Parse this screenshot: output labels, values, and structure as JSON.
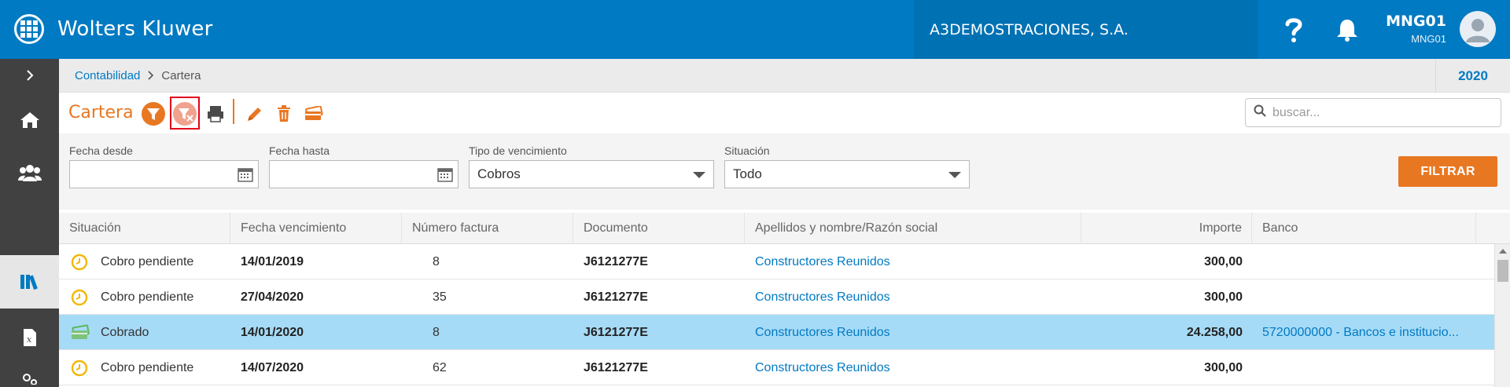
{
  "header": {
    "brand": "Wolters Kluwer",
    "company": "A3DEMOSTRACIONES, S.A.",
    "user_name": "MNG01",
    "user_sub": "MNG01",
    "icons": [
      "logo-icon",
      "help-icon",
      "bell-icon",
      "avatar-icon"
    ]
  },
  "sidebar": {
    "items": [
      {
        "name": "expand",
        "icon": "chevron-right-icon"
      },
      {
        "name": "home",
        "icon": "home-icon"
      },
      {
        "name": "contacts",
        "icon": "users-icon"
      },
      {
        "name": "library",
        "icon": "books-icon",
        "active": true
      },
      {
        "name": "excel",
        "icon": "spreadsheet-icon"
      },
      {
        "name": "settings",
        "icon": "gears-icon"
      }
    ]
  },
  "breadcrumb": {
    "parent": "Contabilidad",
    "separator": ">",
    "current": "Cartera",
    "year": "2020"
  },
  "toolbar": {
    "title": "Cartera",
    "buttons": [
      "filter-icon",
      "clear-filter-icon",
      "print-icon",
      "edit-icon",
      "delete-icon",
      "payment-card-icon"
    ],
    "search_placeholder": "buscar..."
  },
  "filters": {
    "fecha_desde": {
      "label": "Fecha desde",
      "value": ""
    },
    "fecha_hasta": {
      "label": "Fecha hasta",
      "value": ""
    },
    "tipo": {
      "label": "Tipo de vencimiento",
      "value": "Cobros"
    },
    "situacion": {
      "label": "Situación",
      "value": "Todo"
    },
    "button": "FILTRAR"
  },
  "table": {
    "columns": [
      "Situación",
      "Fecha vencimiento",
      "Número factura",
      "Documento",
      "Apellidos y nombre/Razón social",
      "Importe",
      "Banco"
    ],
    "rows": [
      {
        "situacion": "Cobro pendiente",
        "icon": "clock-icon",
        "fecha": "14/01/2019",
        "numero": "8",
        "documento": "J6121277E",
        "nombre": "Constructores Reunidos",
        "importe": "300,00",
        "banco": ""
      },
      {
        "situacion": "Cobro pendiente",
        "icon": "clock-icon",
        "fecha": "27/04/2020",
        "numero": "35",
        "documento": "J6121277E",
        "nombre": "Constructores Reunidos",
        "importe": "300,00",
        "banco": ""
      },
      {
        "situacion": "Cobrado",
        "icon": "money-icon",
        "fecha": "14/01/2020",
        "numero": "8",
        "documento": "J6121277E",
        "nombre": "Constructores Reunidos",
        "importe": "24.258,00",
        "banco": "5720000000 - Bancos e institucio...",
        "selected": true
      },
      {
        "situacion": "Cobro pendiente",
        "icon": "clock-icon",
        "fecha": "14/07/2020",
        "numero": "62",
        "documento": "J6121277E",
        "nombre": "Constructores Reunidos",
        "importe": "300,00",
        "banco": ""
      }
    ]
  },
  "colors": {
    "primary_blue": "#007ac3",
    "accent_orange": "#e87722",
    "selected_row": "#a6dbf7",
    "sidebar": "#414141",
    "highlight_red": "#e2001a"
  }
}
